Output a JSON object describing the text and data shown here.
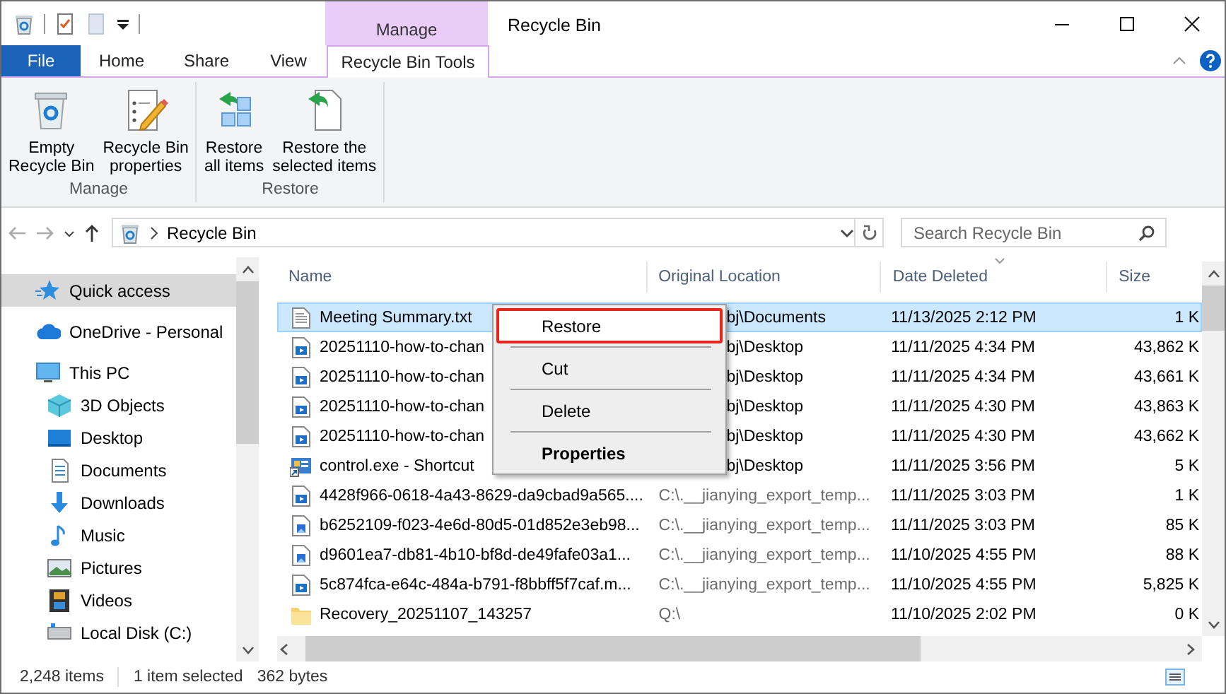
{
  "window": {
    "title": "Recycle Bin",
    "context_tab_group": "Manage"
  },
  "ribbon_tabs": [
    {
      "label": "File",
      "kind": "file",
      "selected": false
    },
    {
      "label": "Home",
      "kind": "tab",
      "selected": false
    },
    {
      "label": "Share",
      "kind": "tab",
      "selected": false
    },
    {
      "label": "View",
      "kind": "tab",
      "selected": false
    },
    {
      "label": "Recycle Bin Tools",
      "kind": "context",
      "selected": true
    }
  ],
  "ribbon_groups": [
    {
      "label": "Manage",
      "commands": [
        {
          "label": "Empty\nRecycle Bin",
          "kind": "bin"
        },
        {
          "label": "Recycle Bin\nproperties",
          "kind": "properties"
        }
      ]
    },
    {
      "label": "Restore",
      "commands": [
        {
          "label": "Restore\nall items",
          "kind": "restore_all"
        },
        {
          "label": "Restore the\nselected items",
          "kind": "restore_selected"
        }
      ]
    }
  ],
  "address": {
    "path": "Recycle Bin"
  },
  "search": {
    "placeholder": "Search Recycle Bin"
  },
  "nav": [
    {
      "label": "Quick access",
      "kind": "star",
      "selected": true
    },
    {
      "label": "OneDrive - Personal",
      "kind": "cloud",
      "selected": false
    },
    {
      "label": "This PC",
      "kind": "pc",
      "selected": false,
      "children": [
        {
          "label": "3D Objects",
          "kind": "cube",
          "selected": false
        },
        {
          "label": "Desktop",
          "kind": "desktop",
          "selected": false
        },
        {
          "label": "Documents",
          "kind": "documents",
          "selected": false
        },
        {
          "label": "Downloads",
          "kind": "downloads",
          "selected": false
        },
        {
          "label": "Music",
          "kind": "music",
          "selected": false
        },
        {
          "label": "Pictures",
          "kind": "pictures",
          "selected": false
        },
        {
          "label": "Videos",
          "kind": "videos",
          "selected": false
        },
        {
          "label": "Local Disk (C:)",
          "kind": "disk",
          "selected": false
        }
      ]
    }
  ],
  "table": {
    "columns": [
      {
        "label": "Name",
        "sorted": false
      },
      {
        "label": "Original Location",
        "sorted": false
      },
      {
        "label": "Date Deleted",
        "sorted": true
      },
      {
        "label": "Size",
        "sorted": false
      }
    ],
    "rows": [
      {
        "kind": "text",
        "name": "Meeting Summary.txt",
        "location": "bj\\Documents",
        "date": "11/13/2025 2:12 PM",
        "size": "1 K",
        "selected": true,
        "covered": true
      },
      {
        "kind": "video",
        "name": "20251110-how-to-chan",
        "location": "bj\\Desktop",
        "date": "11/11/2025 4:34 PM",
        "size": "43,862 K",
        "selected": false,
        "covered": true
      },
      {
        "kind": "video",
        "name": "20251110-how-to-chan",
        "location": "bj\\Desktop",
        "date": "11/11/2025 4:34 PM",
        "size": "43,661 K",
        "selected": false,
        "covered": true
      },
      {
        "kind": "video",
        "name": "20251110-how-to-chan",
        "location": "bj\\Desktop",
        "date": "11/11/2025 4:30 PM",
        "size": "43,863 K",
        "selected": false,
        "covered": true
      },
      {
        "kind": "video",
        "name": "20251110-how-to-chan",
        "location": "bj\\Desktop",
        "date": "11/11/2025 4:30 PM",
        "size": "43,662 K",
        "selected": false,
        "covered": true
      },
      {
        "kind": "shortcut",
        "name": "control.exe - Shortcut",
        "location": "bj\\Desktop",
        "date": "11/11/2025 3:56 PM",
        "size": "5 K",
        "selected": false,
        "covered": true
      },
      {
        "kind": "video",
        "name": "4428f966-0618-4a43-8629-da9cbad9a565....",
        "location": "C:\\.__jianying_export_temp...",
        "date": "11/11/2025 3:03 PM",
        "size": "1 K",
        "selected": false,
        "covered": false
      },
      {
        "kind": "image",
        "name": "b6252109-f023-4e6d-80d5-01d852e3eb98...",
        "location": "C:\\.__jianying_export_temp...",
        "date": "11/11/2025 3:03 PM",
        "size": "85 K",
        "selected": false,
        "covered": false
      },
      {
        "kind": "image",
        "name": "d9601ea7-db81-4b10-bf8d-de49fafe03a1...",
        "location": "C:\\.__jianying_export_temp...",
        "date": "11/10/2025 4:55 PM",
        "size": "88 K",
        "selected": false,
        "covered": false
      },
      {
        "kind": "video",
        "name": "5c874fca-e64c-484a-b791-f8bbff5f7caf.m...",
        "location": "C:\\.__jianying_export_temp...",
        "date": "11/10/2025 4:55 PM",
        "size": "5,825 K",
        "selected": false,
        "covered": false
      },
      {
        "kind": "folder",
        "name": "Recovery_20251107_143257",
        "location": "Q:\\",
        "date": "11/10/2025 2:02 PM",
        "size": "0 K",
        "selected": false,
        "covered": false
      }
    ]
  },
  "context_menu": [
    {
      "label": "Restore",
      "highlighted": true,
      "bold": false
    },
    {
      "label": "Cut",
      "highlighted": false,
      "bold": false
    },
    {
      "label": "Delete",
      "highlighted": false,
      "bold": false
    },
    {
      "label": "Properties",
      "highlighted": false,
      "bold": true
    }
  ],
  "status_bar": {
    "count": "2,248 items",
    "selection": "1 item selected",
    "size": "362 bytes"
  }
}
